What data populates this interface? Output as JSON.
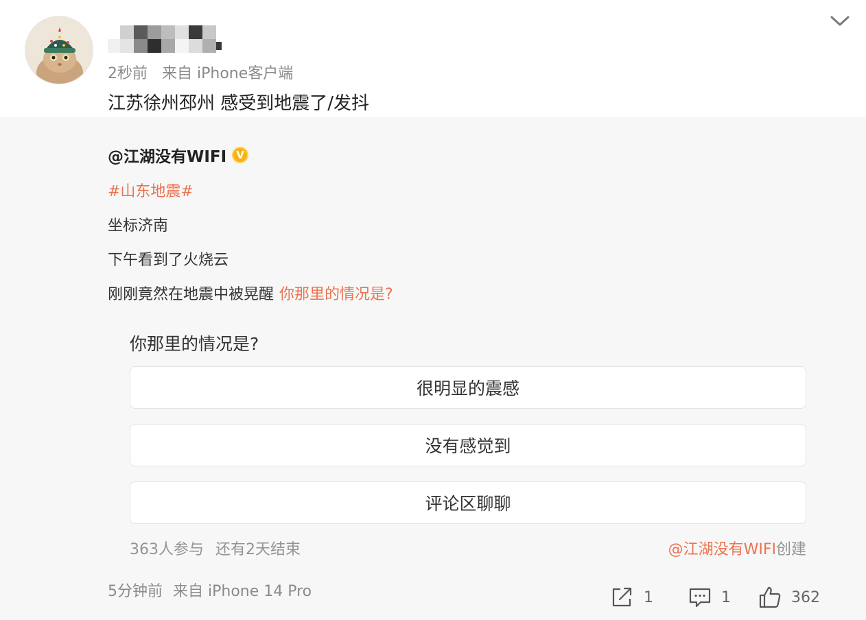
{
  "post": {
    "time": "2秒前",
    "source": "来自 iPhone客户端",
    "text": "江苏徐州邳州 感受到地震了/发抖"
  },
  "repost": {
    "author": "@江湖没有WIFI",
    "verified_badge": "V",
    "hashtag": "#山东地震#",
    "lines": [
      "坐标济南",
      "下午看到了火烧云",
      "刚刚竟然在地震中被晃醒"
    ],
    "inline_link": "你那里的情况是?",
    "vote": {
      "question": "你那里的情况是?",
      "options": [
        "很明显的震感",
        "没有感觉到",
        "评论区聊聊"
      ],
      "participants": "363人参与",
      "remaining": "还有2天结束",
      "creator_link": "@江湖没有WIFI",
      "creator_suffix": "创建"
    },
    "time": "5分钟前",
    "source": "来自 iPhone 14 Pro",
    "actions": {
      "share_count": "1",
      "comment_count": "1",
      "like_count": "362"
    }
  },
  "colors": {
    "accent": "#eb7350",
    "meta_text": "#8a8a8a",
    "repost_bg": "#f7f7f7",
    "verified": "#f6b217"
  },
  "icons": [
    "chevron-down-icon",
    "verified-icon",
    "share-icon",
    "comment-icon",
    "like-icon"
  ]
}
